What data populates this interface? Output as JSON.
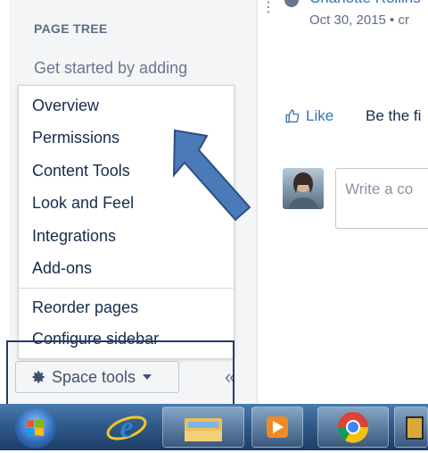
{
  "sidebar": {
    "page_tree_title": "PAGE TREE",
    "get_started": "Get started by adding"
  },
  "menu": {
    "items": [
      "Overview",
      "Permissions",
      "Content Tools",
      "Look and Feel",
      "Integrations",
      "Add-ons",
      "Reorder pages",
      "Configure sidebar"
    ]
  },
  "space_tools": {
    "label": "Space tools",
    "collapse_glyph": "«"
  },
  "content": {
    "author": "Charlotte Rollins",
    "date": "Oct 30, 2015 • cr",
    "like": "Like",
    "be_first": "Be the fi",
    "comment_placeholder": "Write a co"
  },
  "taskbar": {
    "items": [
      "start-icon",
      "internet-explorer-icon",
      "file-explorer-icon",
      "media-player-icon",
      "chrome-icon",
      "window-icon"
    ]
  },
  "colors": {
    "link": "#3572b0",
    "arrow": "#4a7ab8",
    "highlight": "#1f3c6b"
  }
}
